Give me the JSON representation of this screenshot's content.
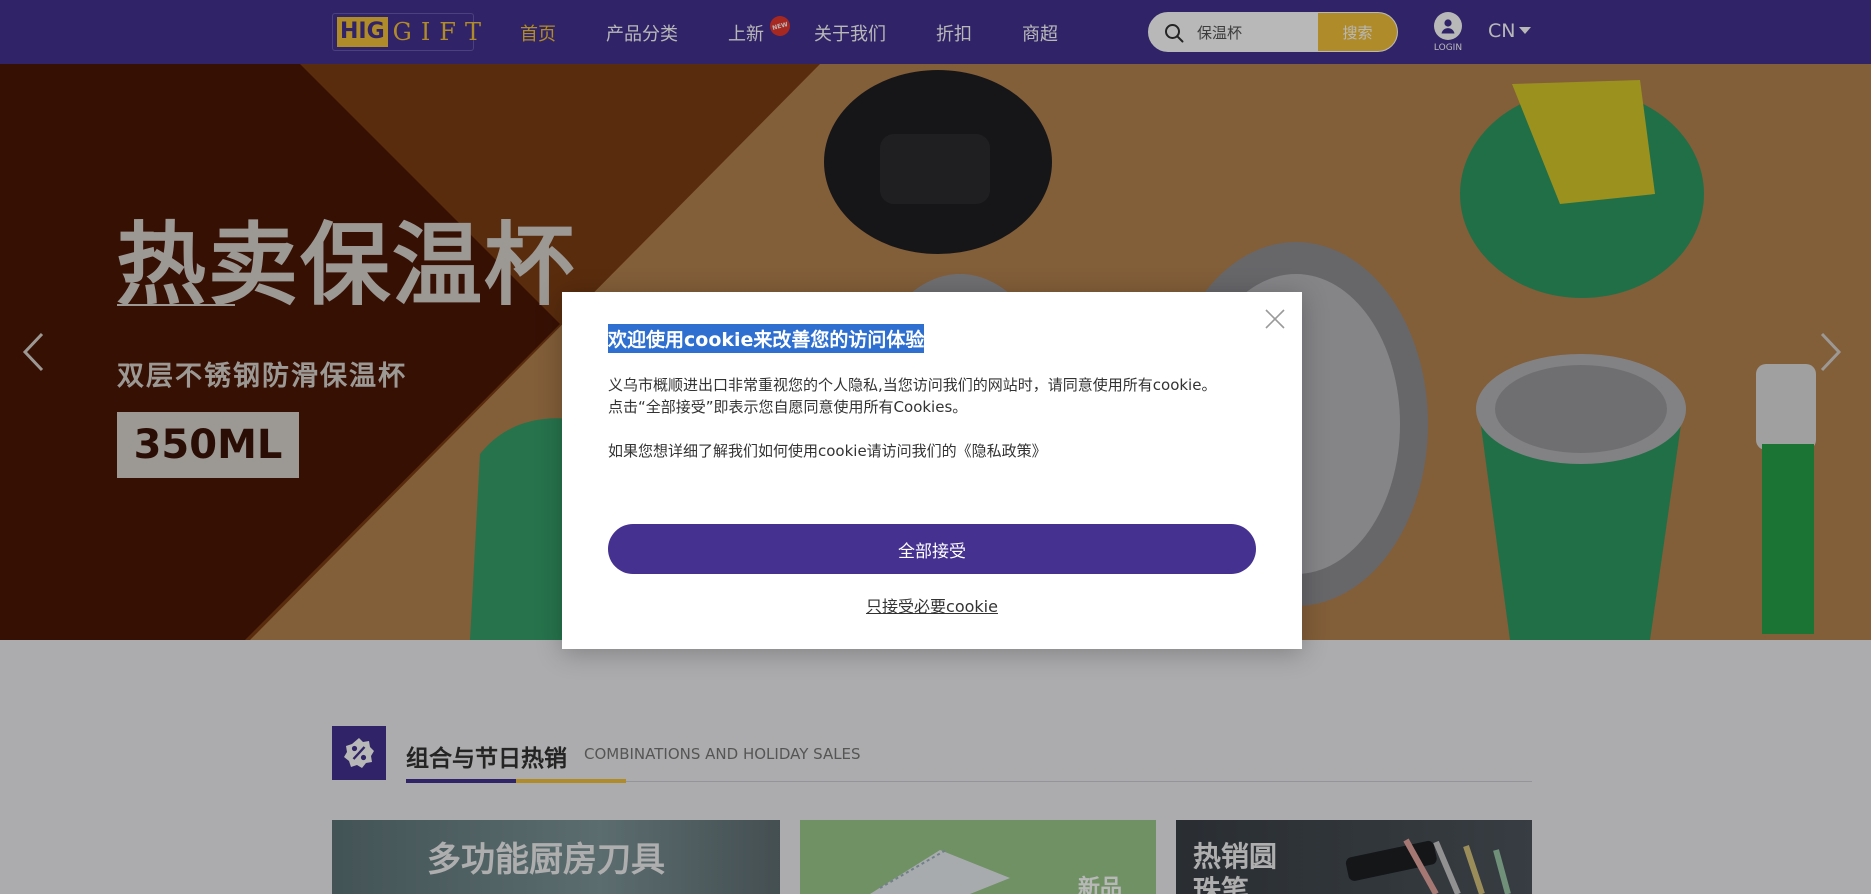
{
  "header": {
    "logo_hig": "HIG",
    "logo_gift": "GIFT",
    "nav": [
      {
        "label": "首页",
        "active": true
      },
      {
        "label": "产品分类",
        "active": false
      },
      {
        "label": "上新",
        "active": false
      },
      {
        "label": "关于我们",
        "active": false
      },
      {
        "label": "折扣",
        "active": false
      },
      {
        "label": "商超",
        "active": false
      }
    ],
    "new_badge": "NEW",
    "search": {
      "value": "保温杯",
      "button": "搜索"
    },
    "login_label": "LOGIN",
    "language": "CN"
  },
  "banner": {
    "title": "热卖保温杯",
    "subtitle": "双层不锈钢防滑保温杯",
    "size": "350ML"
  },
  "section": {
    "title": "组合与节日热销",
    "subtitle_en": "COMBINATIONS AND HOLIDAY SALES"
  },
  "cards": [
    {
      "text": "多功能厨房刀具"
    },
    {
      "text": "新品"
    },
    {
      "text": "热销圆珠笔"
    }
  ],
  "cookie_modal": {
    "title": "欢迎使用cookie来改善您的访问体验",
    "paragraph1_line1": "义乌市概顺进出口非常重视您的个人隐私,当您访问我们的网站时，请同意使用所有cookie。",
    "paragraph1_line2": "点击“全部接受”即表示您自愿同意使用所有Cookies。",
    "paragraph2": "如果您想详细了解我们如何使用cookie请访问我们的《隐私政策》",
    "accept_all": "全部接受",
    "necessary_only": "只接受必要cookie"
  },
  "colors": {
    "brand_purple": "#45318f",
    "brand_yellow": "#f3c13a"
  }
}
